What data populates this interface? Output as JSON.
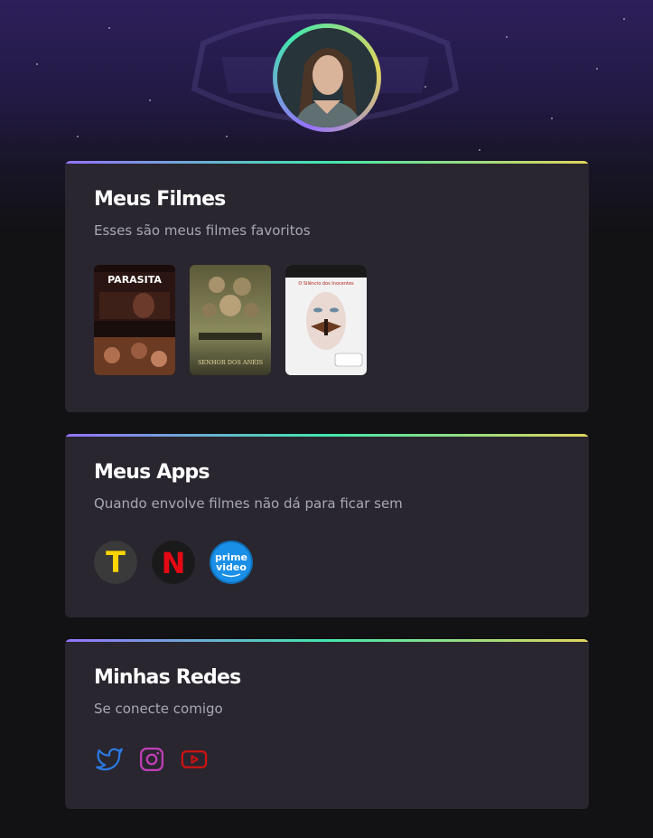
{
  "profile": {
    "avatar_alt": "Foto de perfil"
  },
  "cards": {
    "movies": {
      "title": "Meus Filmes",
      "subtitle": "Esses são meus filmes favoritos",
      "posters": [
        {
          "title": "PARASITA",
          "accent": "#c11f25"
        },
        {
          "title": "SENHOR DOS ANÉIS",
          "accent": "#c9b36a"
        },
        {
          "title": "O Silêncio dos Inocentes",
          "accent": "#c0392b"
        }
      ]
    },
    "apps": {
      "title": "Meus Apps",
      "subtitle": "Quando envolve filmes não dá para ficar sem",
      "items": [
        {
          "name": "TV Time",
          "glyph": "T",
          "icon": "tvtime-icon",
          "color": "#ffd400"
        },
        {
          "name": "Netflix",
          "glyph": "N",
          "icon": "netflix-icon",
          "color": "#e50914"
        },
        {
          "name": "Prime Video",
          "line1": "prime",
          "line2": "video",
          "icon": "primevideo-icon",
          "color": "#1a98ff"
        }
      ]
    },
    "social": {
      "title": "Minhas Redes",
      "subtitle": "Se conecte comigo",
      "items": [
        {
          "name": "Twitter",
          "icon": "twitter-icon",
          "color": "#2a7ae2"
        },
        {
          "name": "Instagram",
          "icon": "instagram-icon",
          "color": "#c13584"
        },
        {
          "name": "YouTube",
          "icon": "youtube-icon",
          "color": "#ce1313"
        }
      ]
    }
  },
  "theme": {
    "gradient": [
      "#9572fc",
      "#43e7ad",
      "#e1d55d"
    ],
    "card_bg": "#29262f",
    "page_bg": "#121214"
  }
}
